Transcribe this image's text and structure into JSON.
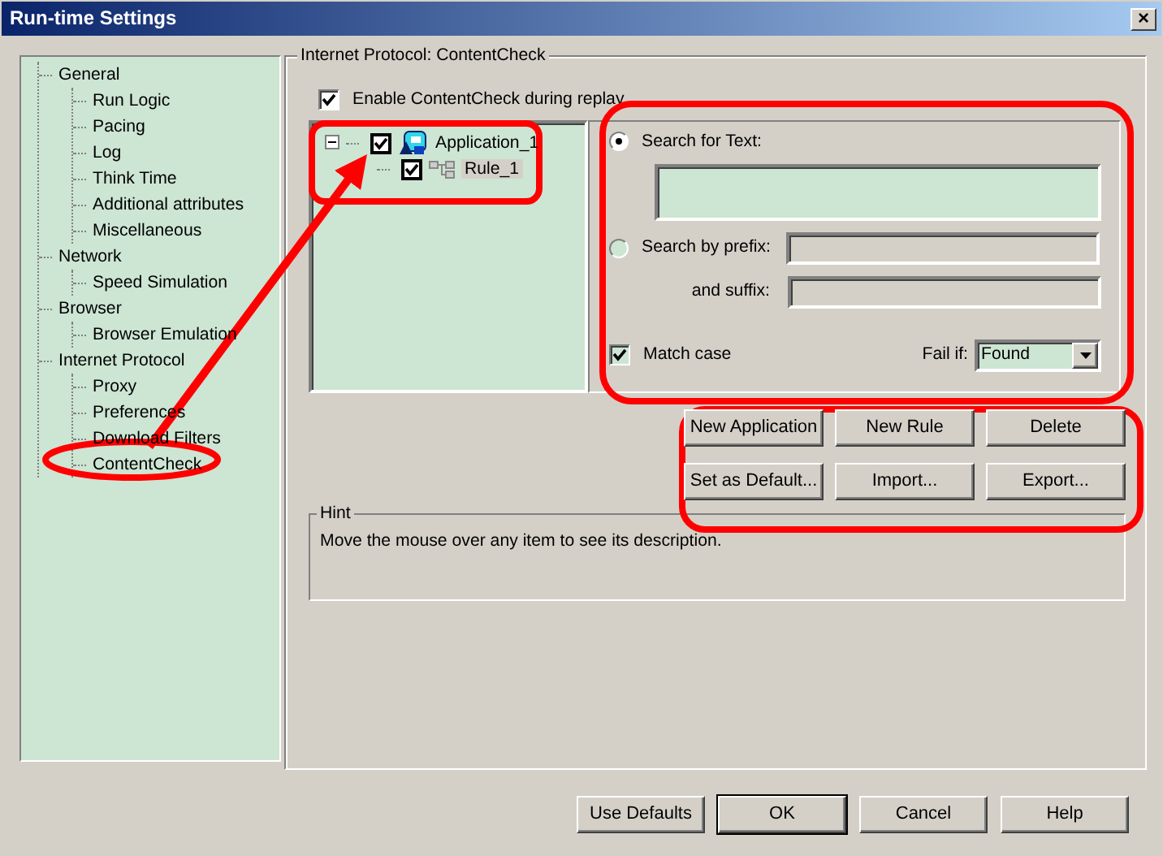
{
  "window": {
    "title": "Run-time Settings",
    "close": "×"
  },
  "nav_tree": [
    {
      "label": "General",
      "selected": false,
      "children": [
        {
          "label": "Run Logic",
          "selected": false
        },
        {
          "label": "Pacing",
          "selected": false
        },
        {
          "label": "Log",
          "selected": false
        },
        {
          "label": "Think Time",
          "selected": false
        },
        {
          "label": "Additional attributes",
          "selected": false
        },
        {
          "label": "Miscellaneous",
          "selected": false
        }
      ]
    },
    {
      "label": "Network",
      "selected": false,
      "children": [
        {
          "label": "Speed Simulation",
          "selected": false
        }
      ]
    },
    {
      "label": "Browser",
      "selected": false,
      "children": [
        {
          "label": "Browser Emulation",
          "selected": false
        }
      ]
    },
    {
      "label": "Internet Protocol",
      "selected": false,
      "children": [
        {
          "label": "Proxy",
          "selected": false
        },
        {
          "label": "Preferences",
          "selected": false
        },
        {
          "label": "Download Filters",
          "selected": false
        },
        {
          "label": "ContentCheck",
          "selected": false
        }
      ]
    }
  ],
  "group_title": "Internet Protocol: ContentCheck",
  "enable": {
    "label": "Enable ContentCheck during replay",
    "checked": true
  },
  "rule_tree": [
    {
      "label": "Application_1",
      "kind": "application",
      "checked": true,
      "expanded": true,
      "selected": false,
      "children": [
        {
          "label": "Rule_1",
          "kind": "rule",
          "checked": true,
          "selected": true
        }
      ]
    }
  ],
  "search_text": {
    "label": "Search for Text:",
    "selected": true,
    "disabled": false
  },
  "search_prefix": {
    "label": "Search by prefix:",
    "selected": false,
    "disabled": true
  },
  "suffix": {
    "label": "and suffix:",
    "disabled": true
  },
  "match_case": {
    "label": "Match case",
    "checked": true
  },
  "fail_if": {
    "label": "Fail if:",
    "value": "Found"
  },
  "rule_buttons": [
    {
      "label": "New Application"
    },
    {
      "label": "New Rule"
    },
    {
      "label": "Delete"
    },
    {
      "label": "Set as Default..."
    },
    {
      "label": "Import..."
    },
    {
      "label": "Export..."
    }
  ],
  "hint": {
    "title": "Hint",
    "text": "Move the mouse over any item to see its description."
  },
  "dialog_buttons": [
    {
      "label": "Use Defaults",
      "default": false
    },
    {
      "label": "OK",
      "default": true
    },
    {
      "label": "Cancel",
      "default": false
    },
    {
      "label": "Help",
      "default": false
    }
  ]
}
